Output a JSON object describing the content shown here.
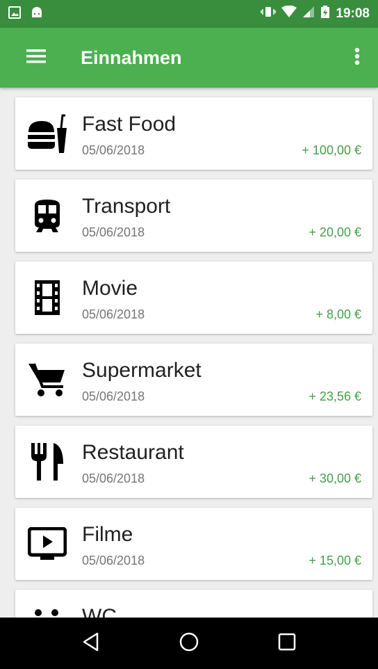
{
  "status_bar": {
    "time": "19:08"
  },
  "app_bar": {
    "title": "Einnahmen"
  },
  "entries": [
    {
      "icon": "fast-food-icon",
      "name": "Fast Food",
      "date": "05/06/2018",
      "amount": "+ 100,00 €"
    },
    {
      "icon": "train-icon",
      "name": "Transport",
      "date": "05/06/2018",
      "amount": "+ 20,00 €"
    },
    {
      "icon": "film-icon",
      "name": "Movie",
      "date": "05/06/2018",
      "amount": "+ 8,00 €"
    },
    {
      "icon": "cart-icon",
      "name": "Supermarket",
      "date": "05/06/2018",
      "amount": "+ 23,56 €"
    },
    {
      "icon": "restaurant-icon",
      "name": "Restaurant",
      "date": "05/06/2018",
      "amount": "+ 30,00 €"
    },
    {
      "icon": "tv-play-icon",
      "name": "Filme",
      "date": "05/06/2018",
      "amount": "+ 15,00 €"
    },
    {
      "icon": "wc-icon",
      "name": "WC",
      "date": "",
      "amount": ""
    }
  ],
  "colors": {
    "status_bar": "#388e3c",
    "app_bar": "#4caf50",
    "amount": "#43a047"
  }
}
